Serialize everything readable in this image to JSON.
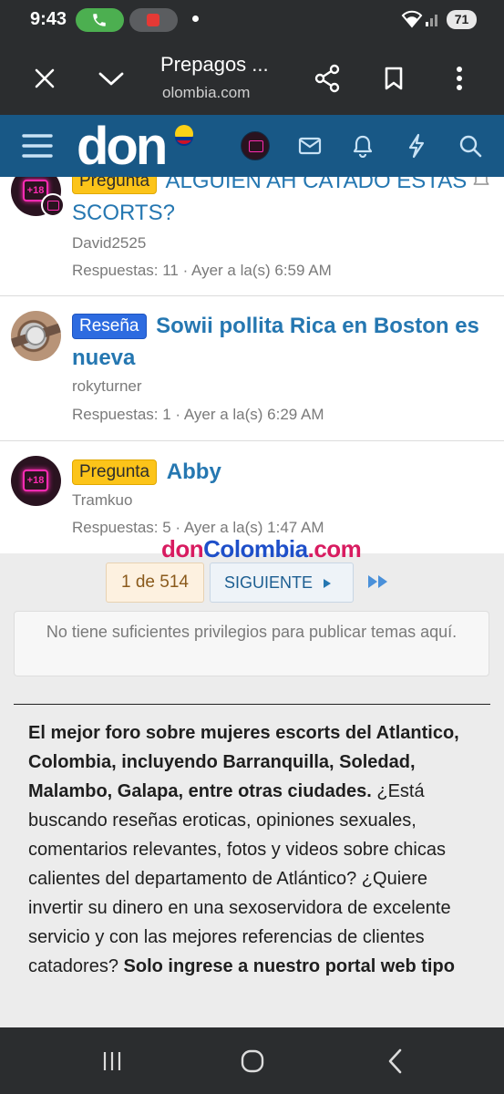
{
  "status_bar": {
    "time": "9:43",
    "battery": "71"
  },
  "toolbar": {
    "title": "Prepagos ...",
    "url": "olombia.com"
  },
  "site": {
    "logo_text": "don",
    "watermark": [
      "don",
      "Colombia",
      ".com"
    ],
    "colors": {
      "header": "#185886",
      "link": "#2577b1",
      "prefix_question": "#fcc419",
      "prefix_review": "#2d6be0"
    }
  },
  "threads": [
    {
      "prefix": "Pregunta",
      "title": "ALGUIEN AH CATADO ESTAS SCORTS?",
      "author": "David2525",
      "meta": "Respuestas: 11 · Ayer a la(s) 6:59 AM"
    },
    {
      "prefix": "Reseña",
      "title": "Sowii pollita Rica en Boston es nueva",
      "author": "rokyturner",
      "meta": "Respuestas: 1 · Ayer a la(s) 6:29 AM"
    },
    {
      "prefix": "Pregunta",
      "title": "Abby",
      "author": "Tramkuo",
      "meta": "Respuestas: 5 · Ayer a la(s) 1:47 AM"
    }
  ],
  "pagination": {
    "current": "1 de 514",
    "next_label": "SIGUIENTE"
  },
  "notice": "No tiene suficientes privilegios para publicar temas aquí.",
  "description": {
    "bold_intro": "El mejor foro sobre mujeres escorts del Atlantico, Colombia, incluyendo Barranquilla, Soledad, Malambo, Galapa, entre otras ciudades.",
    "body": "¿Está buscando reseñas eroticas, opiniones sexuales, comentarios relevantes, fotos y videos sobre chicas calientes del departamento de Atlántico? ¿Quiere invertir su dinero en una sexoservidora de excelente servicio y con las mejores referencias de clientes catadores?",
    "bold_tail": "Solo ingrese a nuestro portal web tipo"
  },
  "icons": {
    "toolbar": [
      "close-icon",
      "chevron-down-icon",
      "share-icon",
      "bookmark-icon",
      "more-vert-icon"
    ],
    "header": [
      "menu-icon",
      "avatar-icon",
      "mail-icon",
      "bell-icon",
      "bolt-icon",
      "search-icon"
    ],
    "nav": [
      "recents-icon",
      "home-icon",
      "back-icon"
    ]
  }
}
